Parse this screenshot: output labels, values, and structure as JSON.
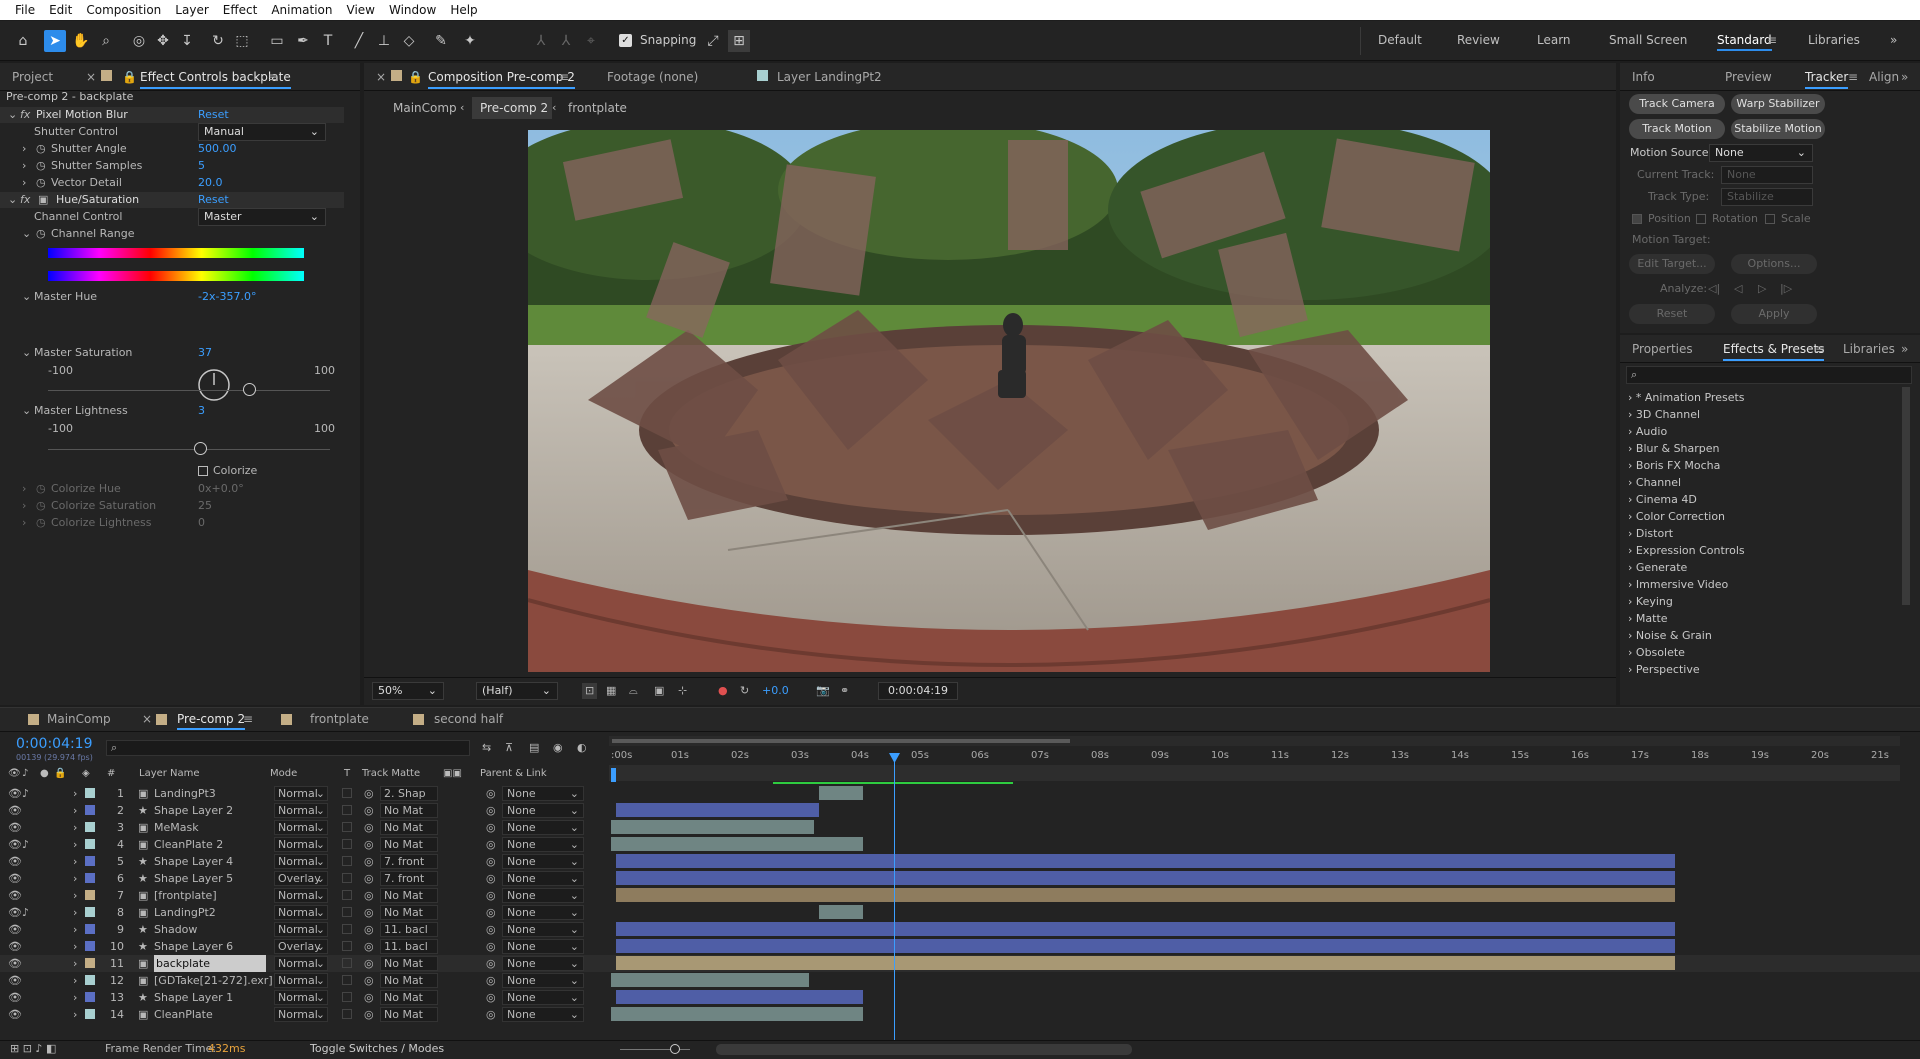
{
  "menu": [
    "File",
    "Edit",
    "Composition",
    "Layer",
    "Effect",
    "Animation",
    "View",
    "Window",
    "Help"
  ],
  "toolbar": {
    "snapping": "Snapping",
    "workspaces": [
      "Default",
      "Review",
      "Learn",
      "Small Screen",
      "Standard",
      "Libraries"
    ]
  },
  "left_panel": {
    "tabs": [
      "Project",
      "Effect Controls backplate"
    ],
    "title": "Pre-comp 2 - backplate",
    "pixel_motion_blur": {
      "name": "Pixel Motion Blur",
      "reset": "Reset",
      "shutter_control_label": "Shutter Control",
      "shutter_control": "Manual",
      "shutter_angle_label": "Shutter Angle",
      "shutter_angle": "500.00",
      "shutter_samples_label": "Shutter Samples",
      "shutter_samples": "5",
      "vector_detail_label": "Vector Detail",
      "vector_detail": "20.0"
    },
    "hue_sat": {
      "name": "Hue/Saturation",
      "reset": "Reset",
      "channel_control_label": "Channel Control",
      "channel_control": "Master",
      "channel_range_label": "Channel Range",
      "master_hue_label": "Master Hue",
      "master_hue": "-2x-357.0°",
      "master_sat_label": "Master Saturation",
      "master_sat": "37",
      "sat_min": "-100",
      "sat_max": "100",
      "master_light_label": "Master Lightness",
      "master_light": "3",
      "light_min": "-100",
      "light_max": "100",
      "colorize": "Colorize",
      "colorize_hue_label": "Colorize Hue",
      "colorize_hue": "0x+0.0°",
      "colorize_sat_label": "Colorize Saturation",
      "colorize_sat": "25",
      "colorize_light_label": "Colorize Lightness",
      "colorize_light": "0"
    }
  },
  "viewer": {
    "tabs": [
      "Composition Pre-comp 2",
      "Footage (none)",
      "Layer LandingPt2"
    ],
    "crumbs": [
      "MainComp",
      "Pre-comp 2",
      "frontplate"
    ],
    "zoom": "50%",
    "resolution": "(Half)",
    "exposure": "+0.0",
    "timecode": "0:00:04:19"
  },
  "tracker": {
    "tabs": [
      "Info",
      "Preview",
      "Tracker",
      "Align"
    ],
    "track_camera": "Track Camera",
    "warp_stabilizer": "Warp Stabilizer",
    "track_motion": "Track Motion",
    "stabilize_motion": "Stabilize Motion",
    "motion_source_label": "Motion Source:",
    "motion_source": "None",
    "current_track_label": "Current Track:",
    "current_track": "None",
    "track_type_label": "Track Type:",
    "track_type": "Stabilize",
    "position": "Position",
    "rotation": "Rotation",
    "scale": "Scale",
    "motion_target": "Motion Target:",
    "edit_target": "Edit Target...",
    "options": "Options...",
    "analyze": "Analyze:",
    "reset": "Reset",
    "apply": "Apply"
  },
  "effects": {
    "tabs": [
      "Properties",
      "Effects & Presets",
      "Libraries"
    ],
    "items": [
      "* Animation Presets",
      "3D Channel",
      "Audio",
      "Blur & Sharpen",
      "Boris FX Mocha",
      "Channel",
      "Cinema 4D",
      "Color Correction",
      "Distort",
      "Expression Controls",
      "Generate",
      "Immersive Video",
      "Keying",
      "Matte",
      "Noise & Grain",
      "Obsolete",
      "Perspective"
    ]
  },
  "timeline": {
    "tabs": [
      "MainComp",
      "Pre-comp 2",
      "frontplate",
      "second half"
    ],
    "timecode": "0:00:04:19",
    "fps": "00139 (29.974 fps)",
    "headers": {
      "num": "#",
      "name": "Layer Name",
      "mode": "Mode",
      "t": "T",
      "matte": "Track Matte",
      "parent": "Parent & Link"
    },
    "ruler": [
      ":00s",
      "01s",
      "02s",
      "03s",
      "04s",
      "05s",
      "06s",
      "07s",
      "08s",
      "09s",
      "10s",
      "11s",
      "12s",
      "13s",
      "14s",
      "15s",
      "16s",
      "17s",
      "18s",
      "19s",
      "20s",
      "21s"
    ],
    "layers": [
      {
        "n": "1",
        "name": "LandingPt3",
        "mode": "Normal",
        "matte": "2. Shap",
        "parent": "None",
        "color": "#a8cfd0"
      },
      {
        "n": "2",
        "name": "Shape Layer 2",
        "mode": "Normal",
        "matte": "No Mat",
        "parent": "None",
        "color": "#5b6fc4"
      },
      {
        "n": "3",
        "name": "MeMask",
        "mode": "Normal",
        "matte": "No Mat",
        "parent": "None",
        "color": "#a8cfd0"
      },
      {
        "n": "4",
        "name": "CleanPlate 2",
        "mode": "Normal",
        "matte": "No Mat",
        "parent": "None",
        "color": "#a8cfd0"
      },
      {
        "n": "5",
        "name": "Shape Layer 4",
        "mode": "Normal",
        "matte": "7. front",
        "parent": "None",
        "color": "#5b6fc4"
      },
      {
        "n": "6",
        "name": "Shape Layer 5",
        "mode": "Overlay",
        "matte": "7. front",
        "parent": "None",
        "color": "#5b6fc4"
      },
      {
        "n": "7",
        "name": "[frontplate]",
        "mode": "Normal",
        "matte": "No Mat",
        "parent": "None",
        "color": "#c4ae86"
      },
      {
        "n": "8",
        "name": "LandingPt2",
        "mode": "Normal",
        "matte": "No Mat",
        "parent": "None",
        "color": "#a8cfd0"
      },
      {
        "n": "9",
        "name": "Shadow",
        "mode": "Normal",
        "matte": "11. bacl",
        "parent": "None",
        "color": "#5b6fc4"
      },
      {
        "n": "10",
        "name": "Shape Layer 6",
        "mode": "Overlay",
        "matte": "11. bacl",
        "parent": "None",
        "color": "#5b6fc4"
      },
      {
        "n": "11",
        "name": "backplate",
        "mode": "Normal",
        "matte": "No Mat",
        "parent": "None",
        "color": "#c4ae86"
      },
      {
        "n": "12",
        "name": "[GDTake[21-272].exr]",
        "mode": "Normal",
        "matte": "No Mat",
        "parent": "None",
        "color": "#a8cfd0"
      },
      {
        "n": "13",
        "name": "Shape Layer 1",
        "mode": "Normal",
        "matte": "No Mat",
        "parent": "None",
        "color": "#5b6fc4"
      },
      {
        "n": "14",
        "name": "CleanPlate",
        "mode": "Normal",
        "matte": "No Mat",
        "parent": "None",
        "color": "#a8cfd0"
      }
    ],
    "frame_render_label": "Frame Render Time:",
    "frame_render": "432ms",
    "toggle": "Toggle Switches / Modes"
  }
}
